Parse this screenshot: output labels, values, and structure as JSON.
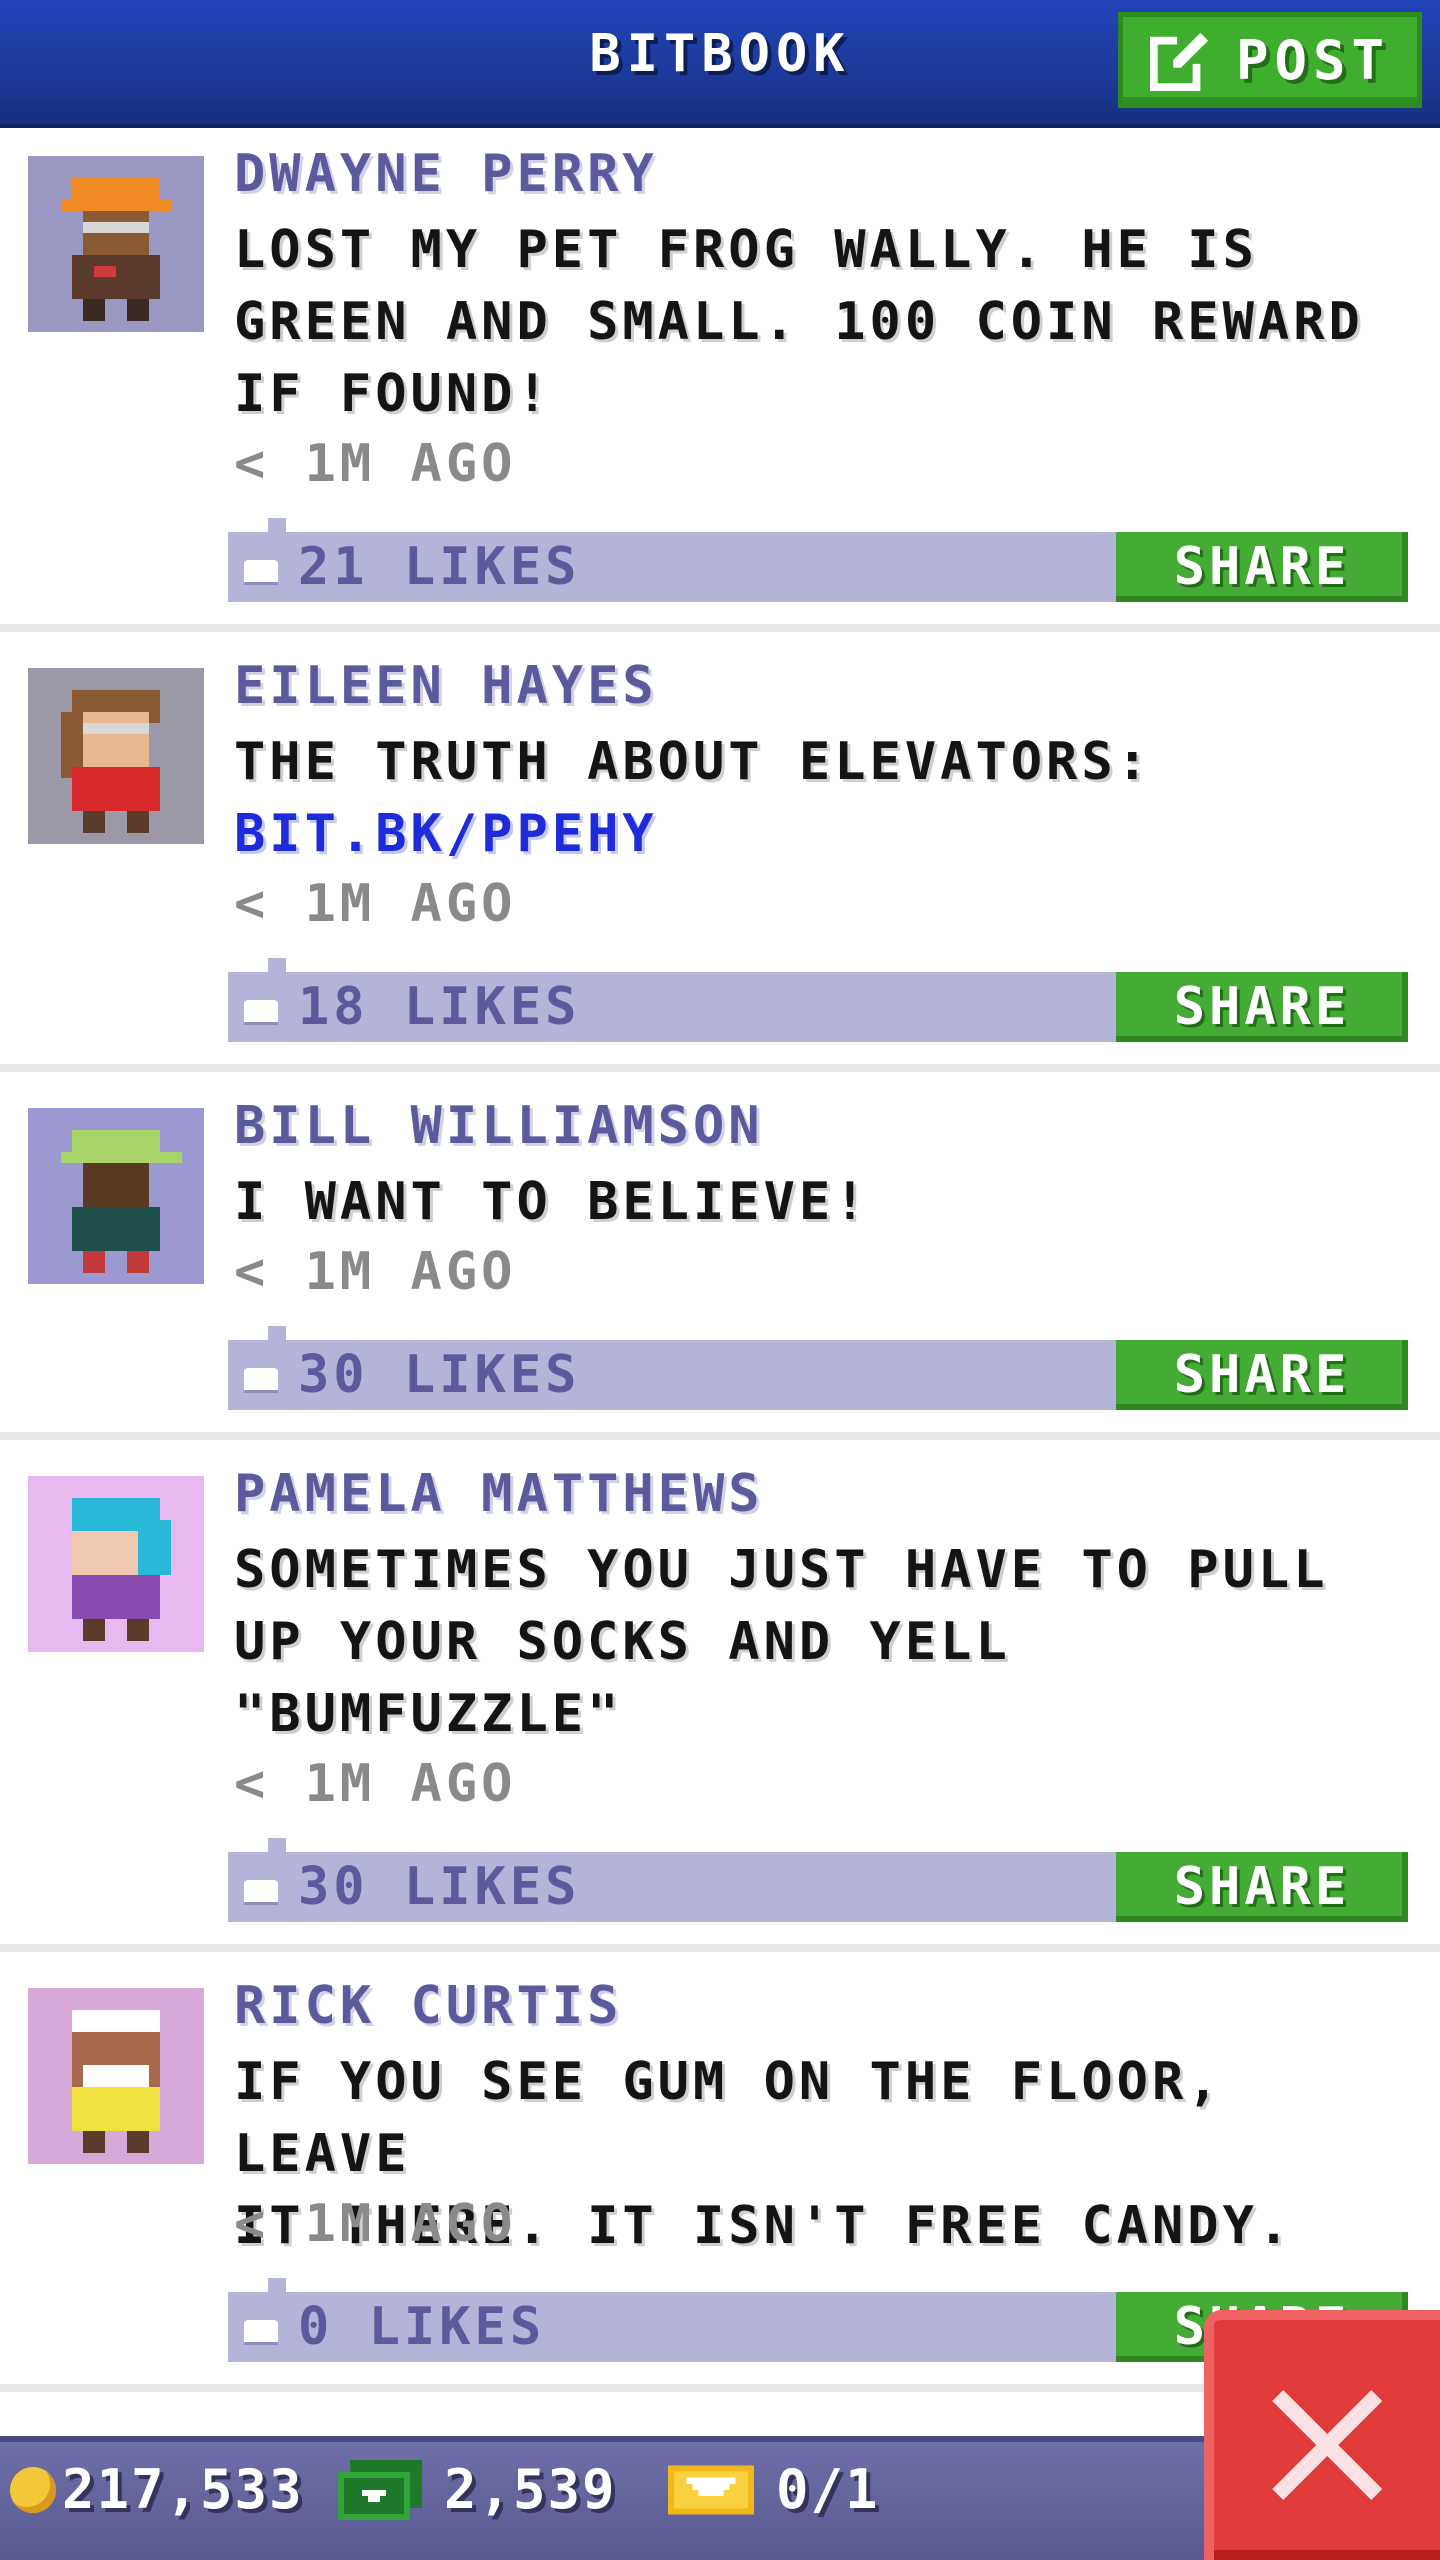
{
  "header": {
    "title": "BITBOOK",
    "post_label": "POST"
  },
  "posts": [
    {
      "author": "DWAYNE PERRY",
      "lines": [
        "LOST MY PET FROG WALLY. HE IS",
        "GREEN AND SMALL. 100 COIN REWARD",
        "IF FOUND!"
      ],
      "link": "",
      "time": "< 1M AGO",
      "likes": "21 LIKES",
      "share_label": "SHARE"
    },
    {
      "author": "EILEEN HAYES",
      "lines": [
        "THE TRUTH ABOUT ELEVATORS:"
      ],
      "link": "BIT.BK/PPEHY",
      "time": "< 1M AGO",
      "likes": "18 LIKES",
      "share_label": "SHARE"
    },
    {
      "author": "BILL WILLIAMSON",
      "lines": [
        "I WANT TO BELIEVE!"
      ],
      "link": "",
      "time": "< 1M AGO",
      "likes": "30 LIKES",
      "share_label": "SHARE"
    },
    {
      "author": "PAMELA MATTHEWS",
      "lines": [
        "SOMETIMES YOU JUST HAVE TO PULL",
        "UP YOUR SOCKS AND YELL",
        "\"BUMFUZZLE\""
      ],
      "link": "",
      "time": "< 1M AGO",
      "likes": "30 LIKES",
      "share_label": "SHARE"
    },
    {
      "author": "RICK CURTIS",
      "lines": [
        "IF YOU SEE GUM ON THE FLOOR, LEAVE",
        "IT THERE. IT ISN'T FREE CANDY."
      ],
      "link": "",
      "time": "< 1M AGO",
      "likes": "0 LIKES",
      "share_label": "SHARE"
    }
  ],
  "status_bar": {
    "coins": "217,533",
    "bux": "2,539",
    "vip": "0/1"
  },
  "icons": {
    "post": "edit-icon",
    "like": "thumbs-up-icon",
    "coin": "coin-icon",
    "bux": "bux-icon",
    "vip": "vip-ticket-icon",
    "close": "close-icon"
  },
  "colors": {
    "header_blue": "#1c3a9a",
    "accent_green": "#44ab34",
    "author_purple": "#5a5a9c",
    "like_bar": "#b4b4d8",
    "link_blue": "#1d2bd8",
    "close_red": "#e03a3a"
  }
}
